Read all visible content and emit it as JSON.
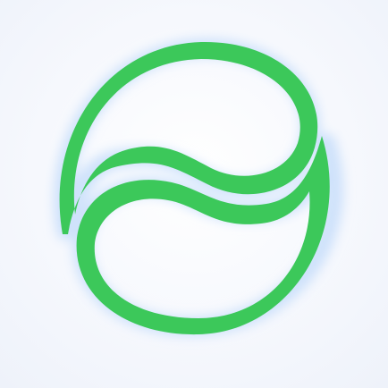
{
  "icon": {
    "name": "app-logo-swirl-icon",
    "colors": {
      "stroke": "#3cc85a",
      "glow": "#cfe2fb",
      "background": "#f4f7fc"
    }
  }
}
